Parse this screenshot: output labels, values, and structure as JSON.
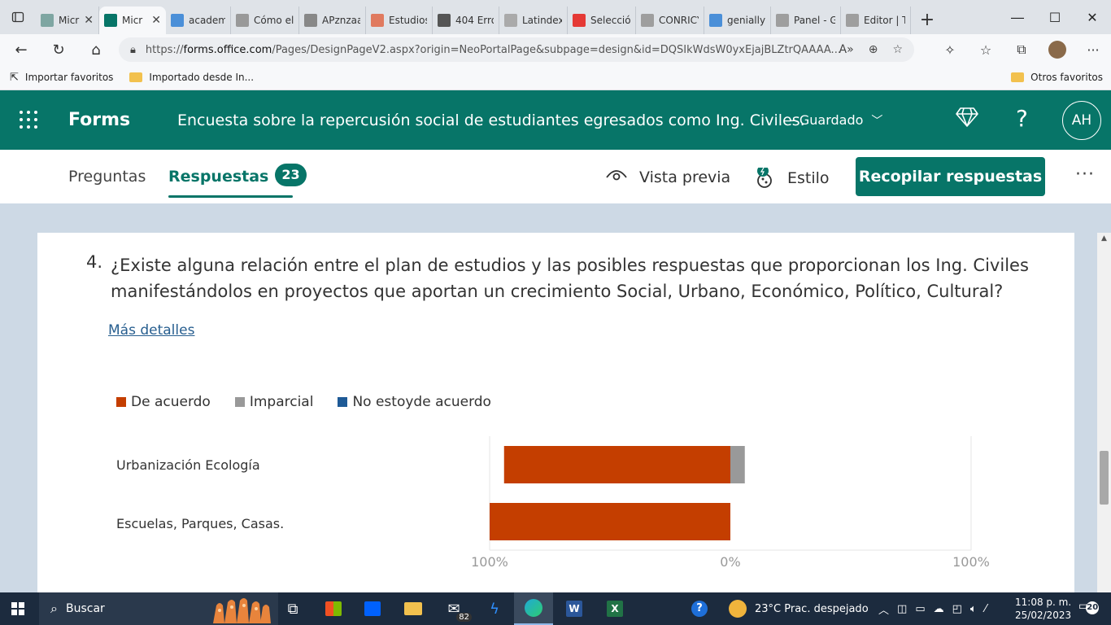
{
  "browser": {
    "tabs": [
      {
        "label": "Micr",
        "favicon": "forms-icon",
        "color": "#7ea6a2",
        "active": false
      },
      {
        "label": "Micr",
        "favicon": "forms-icon",
        "color": "#077568",
        "active": true
      },
      {
        "label": "academi",
        "favicon": "search-icon",
        "color": "#4a8fd8",
        "active": false
      },
      {
        "label": "Cómo el",
        "favicon": "pen-icon",
        "color": "#999999",
        "active": false
      },
      {
        "label": "APznzaa",
        "favicon": "document-icon",
        "color": "#888888",
        "active": false
      },
      {
        "label": "Estudios",
        "favicon": "sm-icon",
        "color": "#e07a5f",
        "active": false
      },
      {
        "label": "404 Error",
        "favicon": "uach-icon",
        "color": "#555555",
        "active": false
      },
      {
        "label": "Latindex",
        "favicon": "info-icon",
        "color": "#aaaaaa",
        "active": false
      },
      {
        "label": "Selección",
        "favicon": "youtube-icon",
        "color": "#e53935",
        "active": false
      },
      {
        "label": "CONRICY",
        "favicon": "tools-icon",
        "color": "#9e9e9e",
        "active": false
      },
      {
        "label": "genially",
        "favicon": "search-icon",
        "color": "#4a8fd8",
        "active": false
      },
      {
        "label": "Panel - G",
        "favicon": "globe-icon",
        "color": "#9e9e9e",
        "active": false
      },
      {
        "label": "Editor | T",
        "favicon": "globe-icon",
        "color": "#9e9e9e",
        "active": false
      }
    ],
    "tab_close": "✕",
    "new_tab": "+",
    "url_prefix": "https://",
    "url_domain": "forms.office.com",
    "url_rest": "/Pages/DesignPageV2.aspx?origin=NeoPortalPage&subpage=design&id=DQSIkWdsW0yxEjajBLZtrQAAAA...",
    "favorites": {
      "import": "Importar favoritos",
      "folder": "Importado desde In...",
      "other": "Otros favoritos"
    }
  },
  "forms": {
    "brand": "Forms",
    "title": "Encuesta sobre la repercusión social de estudiantes egresados como Ing. Civiles.",
    "saved": "-  Guardado",
    "avatar": "AH",
    "nav": {
      "questions": "Preguntas",
      "responses": "Respuestas",
      "responses_count": "23",
      "preview": "Vista previa",
      "style": "Estilo",
      "collect": "Recopilar respuestas"
    }
  },
  "question": {
    "number": "4.",
    "text": "¿Existe alguna relación entre el plan de estudios y las posibles respuestas que proporcionan los Ing. Civiles manifestándolos en proyectos que aportan  un crecimiento Social, Urbano, Económico, Político, Cultural?",
    "details_link": "Más detalles"
  },
  "chart_data": {
    "type": "bar",
    "orientation": "horizontal-diverging",
    "categories": [
      "Urbanización Ecología",
      "Escuelas, Parques, Casas."
    ],
    "series": [
      {
        "name": "De acuerdo",
        "color": "#c43e00",
        "values": [
          -94,
          -100
        ]
      },
      {
        "name": "Imparcial",
        "color": "#999999",
        "values": [
          6,
          0
        ]
      },
      {
        "name": "No estoyde acuerdo",
        "color": "#1e5a96",
        "values": [
          0,
          0
        ]
      }
    ],
    "x_ticks": [
      "100%",
      "0%",
      "100%"
    ],
    "xlim": [
      -100,
      100
    ],
    "legend": "top-left",
    "grid": false
  },
  "taskbar": {
    "search": "Buscar",
    "mail_count": "82",
    "weather": "23°C  Prac. despejado",
    "time": "11:08 p. m.",
    "date": "25/02/2023",
    "notifications": "20"
  }
}
